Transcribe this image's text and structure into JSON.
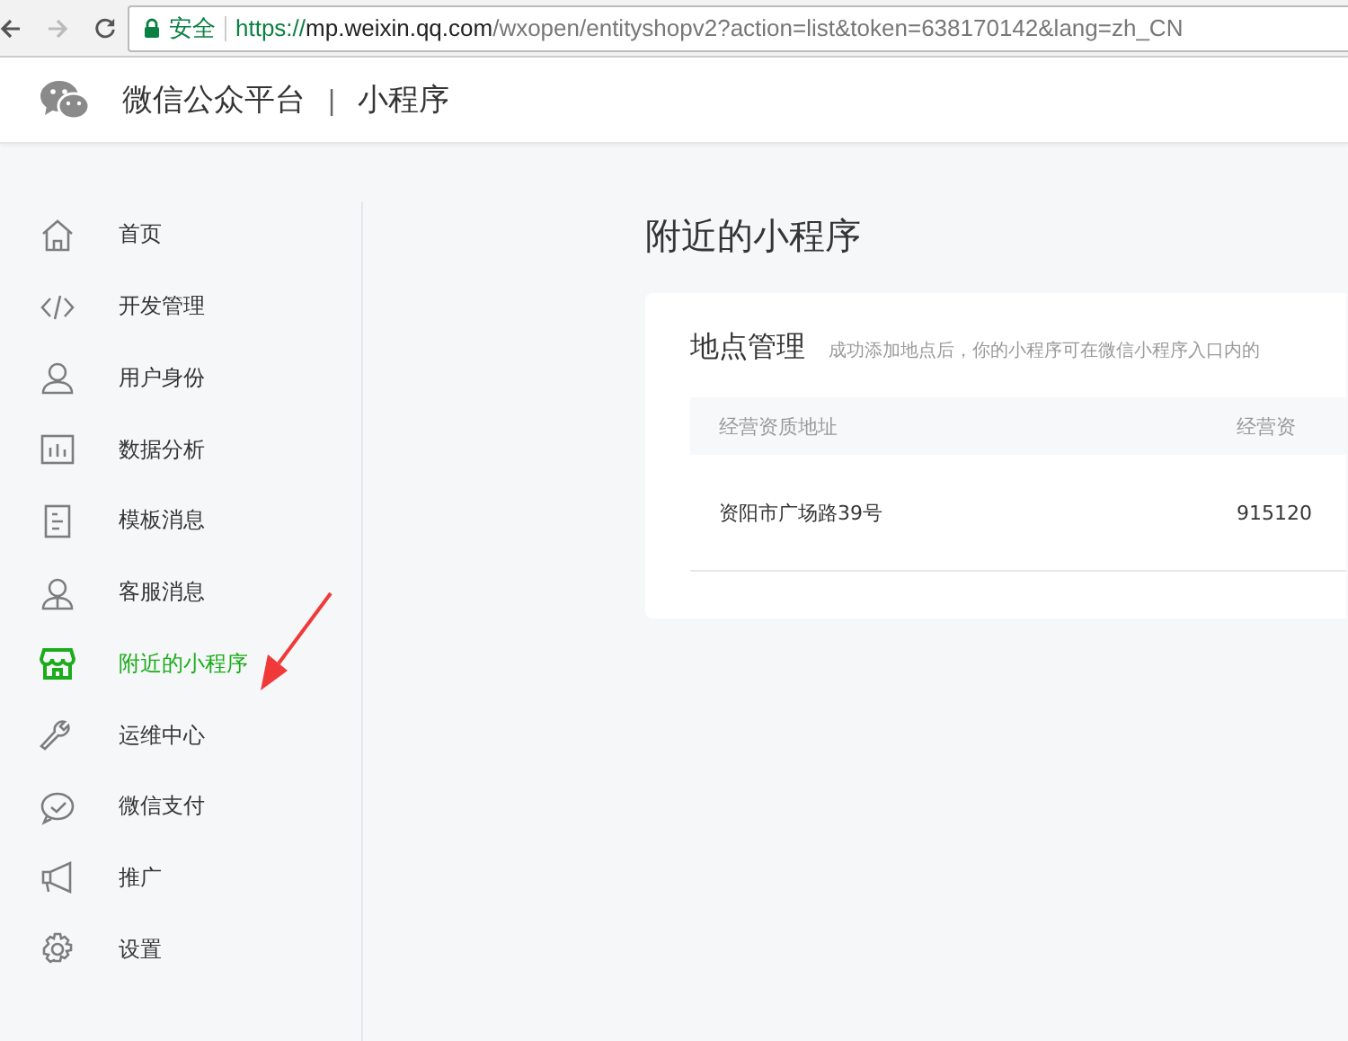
{
  "browser": {
    "security_label": "安全",
    "url": "https://mp.weixin.qq.com/wxopen/entityshopv2?action=list&token=638170142&lang=zh_CN"
  },
  "header": {
    "title": "微信公众平台",
    "separator": "|",
    "subtitle": "小程序"
  },
  "sidebar": {
    "items": [
      {
        "label": "首页",
        "selected": false
      },
      {
        "label": "开发管理",
        "selected": false
      },
      {
        "label": "用户身份",
        "selected": false
      },
      {
        "label": "数据分析",
        "selected": false
      },
      {
        "label": "模板消息",
        "selected": false
      },
      {
        "label": "客服消息",
        "selected": false
      },
      {
        "label": "附近的小程序",
        "selected": true
      },
      {
        "label": "运维中心",
        "selected": false
      },
      {
        "label": "微信支付",
        "selected": false
      },
      {
        "label": "推广",
        "selected": false
      },
      {
        "label": "设置",
        "selected": false
      }
    ]
  },
  "page": {
    "title": "附近的小程序",
    "card": {
      "title": "地点管理",
      "hint": "成功添加地点后，你的小程序可在微信小程序入口内的",
      "table": {
        "columns": [
          "经营资质地址",
          "经营资"
        ],
        "rows": [
          [
            "资阳市广场路39号",
            "915120"
          ]
        ]
      }
    }
  }
}
